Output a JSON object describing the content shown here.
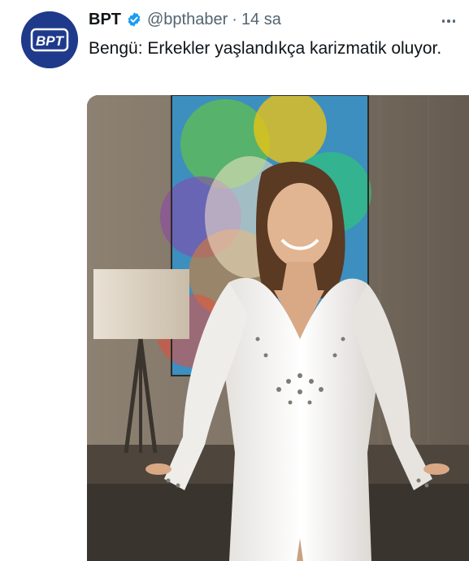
{
  "tweet": {
    "avatar": {
      "logo_text": "BPT",
      "color": "#1f3a8a"
    },
    "display_name": "BPT",
    "verified_icon": "verified-badge-icon",
    "handle": "@bpthaber",
    "separator": "·",
    "time": "14 sa",
    "text": "Bengü: Erkekler yaşlandıkça karizmatik oluyor.",
    "more_icon": "more-options-icon",
    "media": {
      "kind": "photo"
    }
  },
  "colors": {
    "text_primary": "#0f1419",
    "text_secondary": "#536471",
    "verified_blue": "#1d9bf0"
  }
}
